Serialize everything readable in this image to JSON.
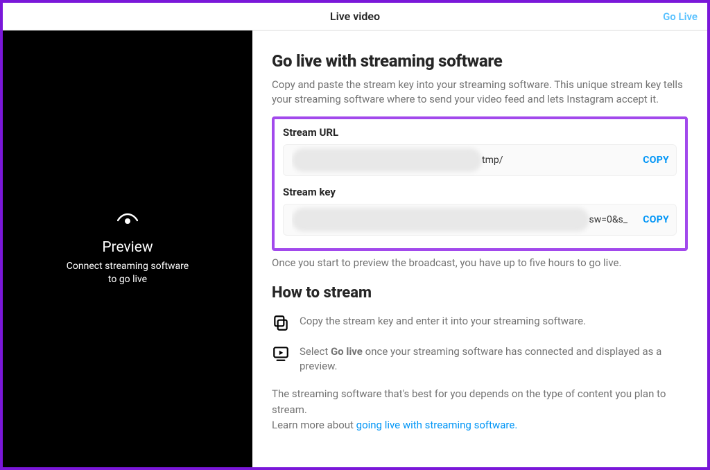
{
  "header": {
    "title": "Live video",
    "action": "Go Live"
  },
  "preview": {
    "title": "Preview",
    "subtitle_line1": "Connect streaming software",
    "subtitle_line2": "to go live"
  },
  "main": {
    "heading": "Go live with streaming software",
    "description": "Copy and paste the stream key into your streaming software. This unique stream key tells your streaming software where to send your video feed and lets Instagram accept it.",
    "stream_url": {
      "label": "Stream URL",
      "visible_tail": "tmp/",
      "copy_label": "COPY"
    },
    "stream_key": {
      "label": "Stream key",
      "visible_tail": "sw=0&s_",
      "copy_label": "COPY"
    },
    "preview_note": "Once you start to preview the broadcast, you have up to five hours to go live.",
    "how_heading": "How to stream",
    "step1": "Copy the stream key and enter it into your streaming software.",
    "step2_pre": "Select ",
    "step2_bold": "Go live",
    "step2_post": " once your streaming software has connected and displayed as a preview.",
    "footer_text": "The streaming software that's best for you depends on the type of content you plan to stream.",
    "learn_more_pre": "Learn more about ",
    "learn_more_link": "going live with streaming software."
  }
}
